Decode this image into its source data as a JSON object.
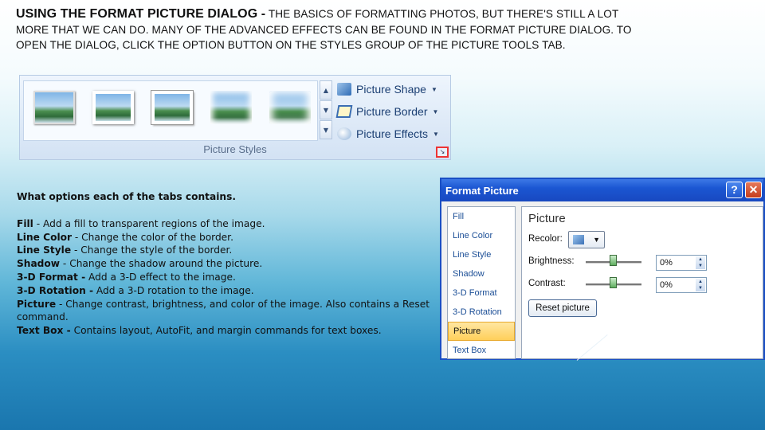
{
  "slide": {
    "heading": "USING THE FORMAT PICTURE DIALOG -",
    "body_line1": "THE BASICS OF FORMATTING PHOTOS,",
    "body_rest": "BUT THERE'S STILL A LOT MORE THAT WE CAN DO. MANY OF THE ADVANCED EFFECTS CAN BE FOUND IN THE FORMAT PICTURE DIALOG. TO OPEN THE DIALOG, CLICK THE OPTION BUTTON ON THE STYLES GROUP OF THE PICTURE TOOLS TAB."
  },
  "ribbon": {
    "buttons": [
      {
        "label": "Picture Shape",
        "icon": "picture-shape-icon"
      },
      {
        "label": "Picture Border",
        "icon": "picture-border-icon"
      },
      {
        "label": "Picture Effects",
        "icon": "picture-effects-icon"
      }
    ],
    "group_label": "Picture Styles"
  },
  "info": {
    "subhead": "What options each of the tabs contains.",
    "items": [
      {
        "term": "Fill",
        "desc": " - Add a fill to transparent regions of the image."
      },
      {
        "term": "Line Color",
        "desc": " - Change the color of the border."
      },
      {
        "term": "Line Style",
        "desc": " - Change the style of the border."
      },
      {
        "term": "Shadow",
        "desc": " - Change the shadow around the picture."
      },
      {
        "term": "3-D Format -",
        "desc": "  Add a 3-D effect to the image."
      },
      {
        "term": "3-D Rotation -",
        "desc": " Add a 3-D rotation to the image."
      },
      {
        "term": "Picture",
        "desc": " - Change contrast, brightness, and color of the image. Also contains a Reset command."
      },
      {
        "term": "Text Box -",
        "desc": " Contains layout, AutoFit, and margin commands for text boxes."
      }
    ]
  },
  "dialog": {
    "title": "Format Picture",
    "help": "?",
    "close": "✕",
    "tabs": [
      "Fill",
      "Line Color",
      "Line Style",
      "Shadow",
      "3-D Format",
      "3-D Rotation",
      "Picture",
      "Text Box"
    ],
    "active_tab": "Picture",
    "panel": {
      "title": "Picture",
      "recolor_label": "Recolor:",
      "brightness_label": "Brightness:",
      "brightness_value": "0%",
      "contrast_label": "Contrast:",
      "contrast_value": "0%",
      "reset_label": "Reset picture"
    }
  },
  "colors": {
    "titlebar": "#1b56d2",
    "active_tab": "#ffcf5a",
    "close_button": "#c63d1c"
  }
}
